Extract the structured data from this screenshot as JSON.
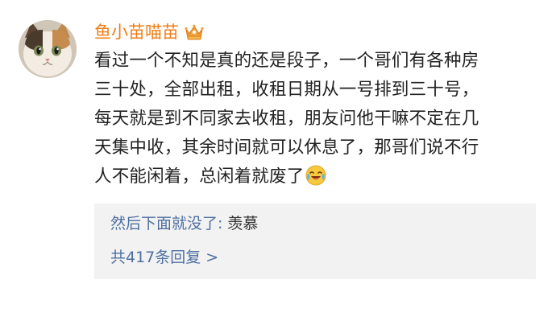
{
  "comment": {
    "username": "鱼小苗喵苗",
    "badge_icon": "crown-icon",
    "username_color": "#ef7d16",
    "text_lines": [
      "看过一个不知是真的还是段子，一个哥们有各种房",
      "三十处，全部出租，收租日期从一号排到三十号，",
      "每天就是到不同家去收租，朋友问他干嘛不定在几",
      "天集中收，其余时间就可以休息了，那哥们说不行",
      "人不能闲着，总闲着就废了"
    ],
    "trailing_emoji": "laugh-cry-emoji"
  },
  "replies": {
    "first_reply": {
      "author": "然后下面就没了",
      "colon": ":",
      "content": "羡慕"
    },
    "more_link": "共417条回复 >",
    "link_color": "#4e6fa1",
    "background": "#f2f2f2"
  }
}
